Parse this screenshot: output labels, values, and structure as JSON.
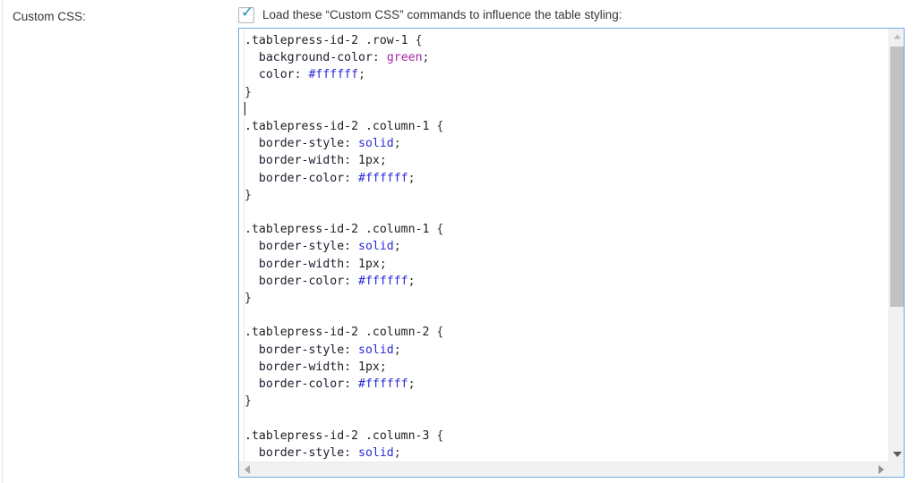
{
  "row": {
    "label": "Custom CSS:"
  },
  "toggle": {
    "checked": true,
    "check_glyph": "✓",
    "label": "Load these “Custom CSS” commands to influence the table styling:"
  },
  "editor": {
    "language": "css",
    "caret_line": 5,
    "lines": [
      ".tablepress-id-2 .row-1 {",
      "  background-color: green;",
      "  color: #ffffff;",
      "}",
      "",
      ".tablepress-id-2 .column-1 {",
      "  border-style: solid;",
      "  border-width: 1px;",
      "  border-color: #ffffff;",
      "}",
      "",
      ".tablepress-id-2 .column-1 {",
      "  border-style: solid;",
      "  border-width: 1px;",
      "  border-color: #ffffff;",
      "}",
      "",
      ".tablepress-id-2 .column-2 {",
      "  border-style: solid;",
      "  border-width: 1px;",
      "  border-color: #ffffff;",
      "}",
      "",
      ".tablepress-id-2 .column-3 {",
      "  border-style: solid;"
    ],
    "tokens": [
      [
        [
          "sel",
          ".tablepress-id-2 .row-1 "
        ],
        [
          "brace",
          "{"
        ]
      ],
      [
        [
          "prop",
          "  background-color"
        ],
        [
          "punct",
          ": "
        ],
        [
          "colorname",
          "green"
        ],
        [
          "punct",
          ";"
        ]
      ],
      [
        [
          "prop",
          "  color"
        ],
        [
          "punct",
          ": "
        ],
        [
          "hex",
          "#ffffff"
        ],
        [
          "punct",
          ";"
        ]
      ],
      [
        [
          "brace",
          "}"
        ]
      ],
      [
        [
          "caret",
          ""
        ]
      ],
      [
        [
          "sel",
          ".tablepress-id-2 .column-1 "
        ],
        [
          "brace",
          "{"
        ]
      ],
      [
        [
          "prop",
          "  border-style"
        ],
        [
          "punct",
          ": "
        ],
        [
          "kw",
          "solid"
        ],
        [
          "punct",
          ";"
        ]
      ],
      [
        [
          "prop",
          "  border-width"
        ],
        [
          "punct",
          ": "
        ],
        [
          "num",
          "1px"
        ],
        [
          "punct",
          ";"
        ]
      ],
      [
        [
          "prop",
          "  border-color"
        ],
        [
          "punct",
          ": "
        ],
        [
          "hex",
          "#ffffff"
        ],
        [
          "punct",
          ";"
        ]
      ],
      [
        [
          "brace",
          "}"
        ]
      ],
      [],
      [
        [
          "sel",
          ".tablepress-id-2 .column-1 "
        ],
        [
          "brace",
          "{"
        ]
      ],
      [
        [
          "prop",
          "  border-style"
        ],
        [
          "punct",
          ": "
        ],
        [
          "kw",
          "solid"
        ],
        [
          "punct",
          ";"
        ]
      ],
      [
        [
          "prop",
          "  border-width"
        ],
        [
          "punct",
          ": "
        ],
        [
          "num",
          "1px"
        ],
        [
          "punct",
          ";"
        ]
      ],
      [
        [
          "prop",
          "  border-color"
        ],
        [
          "punct",
          ": "
        ],
        [
          "hex",
          "#ffffff"
        ],
        [
          "punct",
          ";"
        ]
      ],
      [
        [
          "brace",
          "}"
        ]
      ],
      [],
      [
        [
          "sel",
          ".tablepress-id-2 .column-2 "
        ],
        [
          "brace",
          "{"
        ]
      ],
      [
        [
          "prop",
          "  border-style"
        ],
        [
          "punct",
          ": "
        ],
        [
          "kw",
          "solid"
        ],
        [
          "punct",
          ";"
        ]
      ],
      [
        [
          "prop",
          "  border-width"
        ],
        [
          "punct",
          ": "
        ],
        [
          "num",
          "1px"
        ],
        [
          "punct",
          ";"
        ]
      ],
      [
        [
          "prop",
          "  border-color"
        ],
        [
          "punct",
          ": "
        ],
        [
          "hex",
          "#ffffff"
        ],
        [
          "punct",
          ";"
        ]
      ],
      [
        [
          "brace",
          "}"
        ]
      ],
      [],
      [
        [
          "sel",
          ".tablepress-id-2 .column-3 "
        ],
        [
          "brace",
          "{"
        ]
      ],
      [
        [
          "prop",
          "  border-style"
        ],
        [
          "punct",
          ": "
        ],
        [
          "kw",
          "solid"
        ],
        [
          "punct",
          ";"
        ]
      ]
    ],
    "colors": {
      "selector": "#1f1f1f",
      "property": "#1c1c2e",
      "keyword": "#2b2bd6",
      "hex_value": "#2b2bd6",
      "number": "#20201a",
      "color_name": "#a626a6",
      "border": "#70a9e6",
      "background": "#ffffff"
    }
  },
  "scrollbars": {
    "vertical": {
      "up_arrow": "▲",
      "down_arrow": "▼",
      "thumb_top_pct": 4,
      "thumb_height_pct": 60
    },
    "horizontal": {
      "left_arrow": "◀",
      "right_arrow": "▶"
    }
  }
}
